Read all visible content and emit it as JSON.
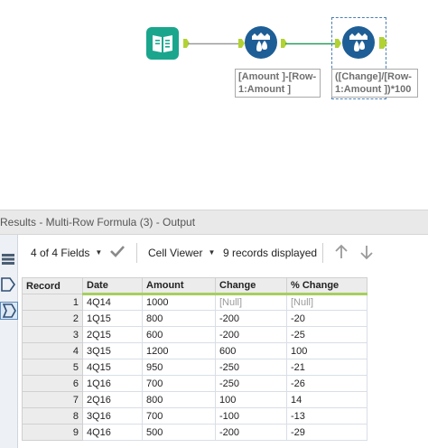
{
  "workflow": {
    "tools": [
      {
        "name": "input-data-tool",
        "icon": "book-icon",
        "color": "#1aa68d"
      },
      {
        "name": "multi-row-formula-tool-1",
        "icon": "multi-row-formula-icon",
        "color": "#1e5e96",
        "label_lines": [
          "[Amount ]-[Row-",
          "1:Amount ]"
        ]
      },
      {
        "name": "multi-row-formula-tool-2",
        "icon": "multi-row-formula-icon",
        "color": "#1e5e96",
        "label_lines": [
          "([Change]/[Row-",
          "1:Amount ])*100"
        ]
      }
    ],
    "anchor_color": "#b2d234",
    "connection_colors": [
      "#9a9a9a",
      "#2a9d5c"
    ]
  },
  "results": {
    "title": "Results - Multi-Row Formula (3) - Output",
    "toolbar": {
      "fields_label": "4 of 4 Fields",
      "viewer_label": "Cell Viewer",
      "records_label": "9 records displayed"
    },
    "columns": [
      "Record",
      "Date",
      "Amount",
      "Change",
      "% Change"
    ],
    "rows": [
      [
        "1",
        "4Q14",
        "1000",
        "[Null]",
        "[Null]"
      ],
      [
        "2",
        "1Q15",
        "800",
        "-200",
        "-20"
      ],
      [
        "3",
        "2Q15",
        "600",
        "-200",
        "-25"
      ],
      [
        "4",
        "3Q15",
        "1200",
        "600",
        "100"
      ],
      [
        "5",
        "4Q15",
        "950",
        "-250",
        "-21"
      ],
      [
        "6",
        "1Q16",
        "700",
        "-250",
        "-26"
      ],
      [
        "7",
        "2Q16",
        "800",
        "100",
        "14"
      ],
      [
        "8",
        "3Q16",
        "700",
        "-100",
        "-13"
      ],
      [
        "9",
        "4Q16",
        "500",
        "-200",
        "-29"
      ]
    ],
    "accent_color": "#a6cf5e"
  }
}
